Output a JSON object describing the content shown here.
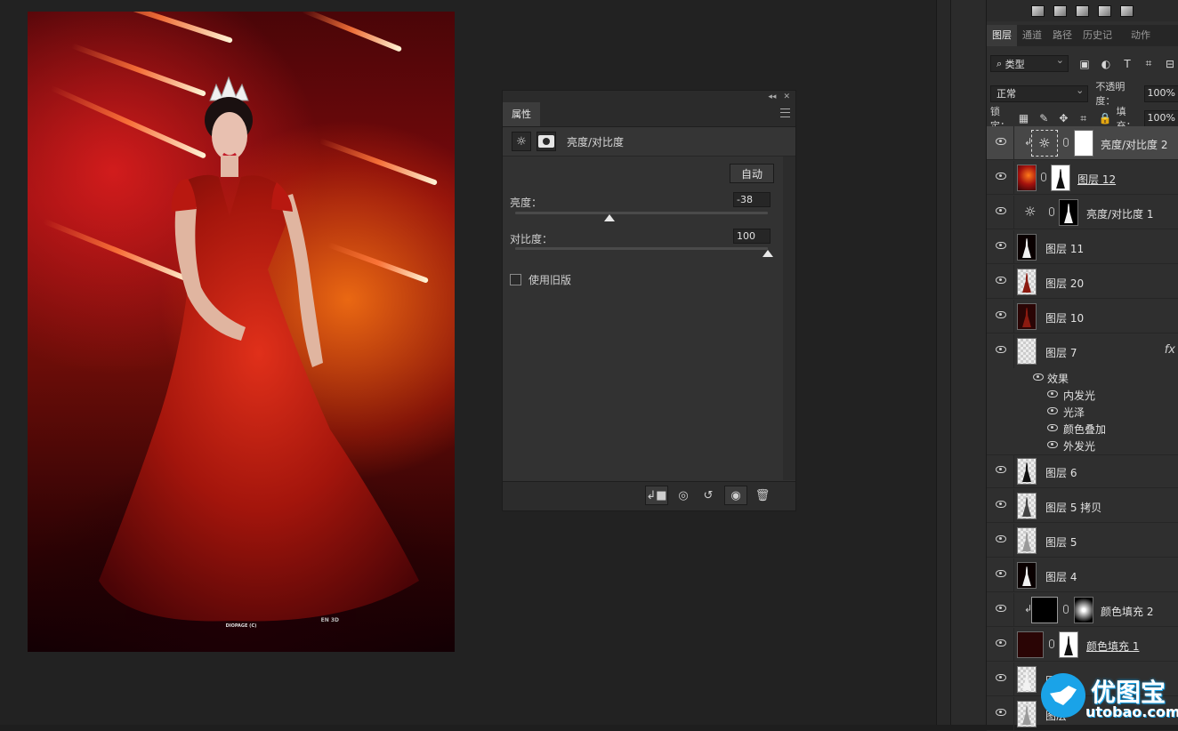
{
  "document": {
    "caption_line1": "EN 3D",
    "caption_line2": "DIOPAGE (C)"
  },
  "properties_panel": {
    "tab": "属性",
    "title": "亮度/对比度",
    "auto_button": "自动",
    "brightness_label": "亮度：",
    "brightness_value": "-38",
    "brightness_level": -38,
    "contrast_label": "对比度：",
    "contrast_value": "100",
    "contrast_level": 100,
    "legacy_label": "使用旧版",
    "legacy_checked": false
  },
  "layers_panel": {
    "tabs": [
      "图层",
      "通道",
      "路径",
      "历史记录",
      "动作"
    ],
    "filter_label": "类型",
    "blend_mode": "正常",
    "opacity_label": "不透明度：",
    "opacity_value": "100%",
    "lock_label": "锁定：",
    "fill_label": "填充：",
    "fill_value": "100%",
    "layers": [
      {
        "name": "亮度/对比度 2",
        "selected": true
      },
      {
        "name": "图层 12"
      },
      {
        "name": "亮度/对比度 1"
      },
      {
        "name": "图层 11"
      },
      {
        "name": "图层 20"
      },
      {
        "name": "图层 10"
      },
      {
        "name": "图层 7",
        "fx": "fx"
      },
      {
        "name": "图层 6"
      },
      {
        "name": "图层 5 拷贝"
      },
      {
        "name": "图层 5"
      },
      {
        "name": "图层 4"
      },
      {
        "name": "颜色填充 2"
      },
      {
        "name": "颜色填充 1"
      },
      {
        "name": "图层 3"
      },
      {
        "name": "图层"
      }
    ],
    "effects": {
      "header": "效果",
      "items": [
        "内发光",
        "光泽",
        "颜色叠加",
        "外发光"
      ]
    }
  },
  "watermark": {
    "text": "优图宝",
    "url": "utobao.com"
  },
  "colors": {
    "panel_bg": "#323232",
    "canvas_bg": "#222222",
    "accent_blue": "#1aa3e8"
  }
}
